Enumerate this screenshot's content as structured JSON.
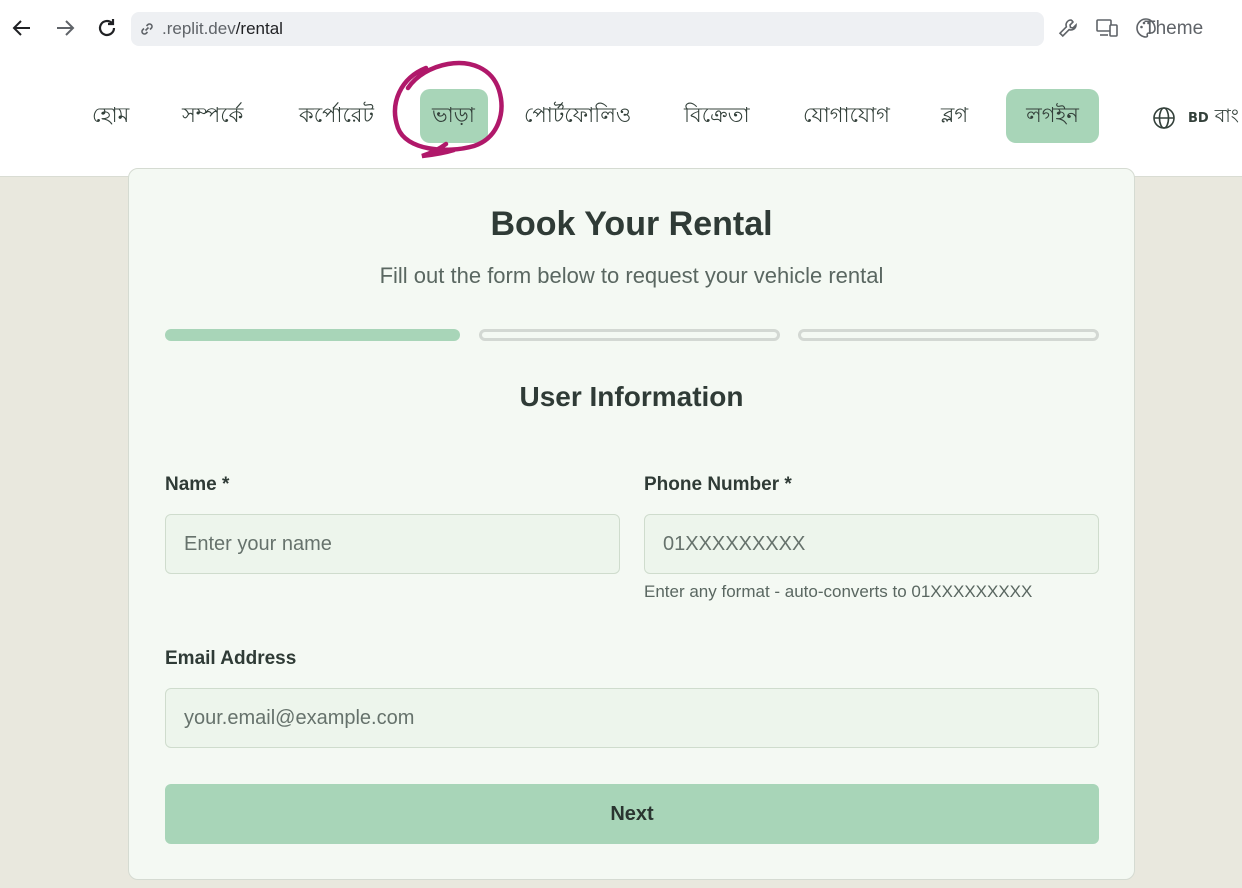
{
  "browser": {
    "url_host": ".replit.dev",
    "url_path": "/rental",
    "theme_label": "Theme"
  },
  "header": {
    "nav_items": [
      "হোম",
      "সম্পর্কে",
      "কর্পোরেট",
      "ভাড়া",
      "পোর্টফোলিও",
      "বিক্রেতা",
      "যোগাযোগ",
      "ব্লগ"
    ],
    "active_item": "ভাড়া",
    "login_label": "লগইন",
    "language_code": "BD",
    "language_label": "বাং"
  },
  "form": {
    "title": "Book Your Rental",
    "subtitle": "Fill out the form below to request your vehicle rental",
    "steps": {
      "total": 3,
      "current": 1
    },
    "section_title": "User Information",
    "name_label": "Name *",
    "name_placeholder": "Enter your name",
    "phone_label": "Phone Number *",
    "phone_placeholder": "01XXXXXXXXX",
    "phone_hint": "Enter any format - auto-converts to 01XXXXXXXXX",
    "email_label": "Email Address",
    "email_placeholder": "your.email@example.com",
    "next_label": "Next"
  },
  "colors": {
    "accent": "#a8d5b8",
    "page_background": "#e9e8de",
    "card_background": "#f4f9f3",
    "annotation": "#b0186a"
  }
}
